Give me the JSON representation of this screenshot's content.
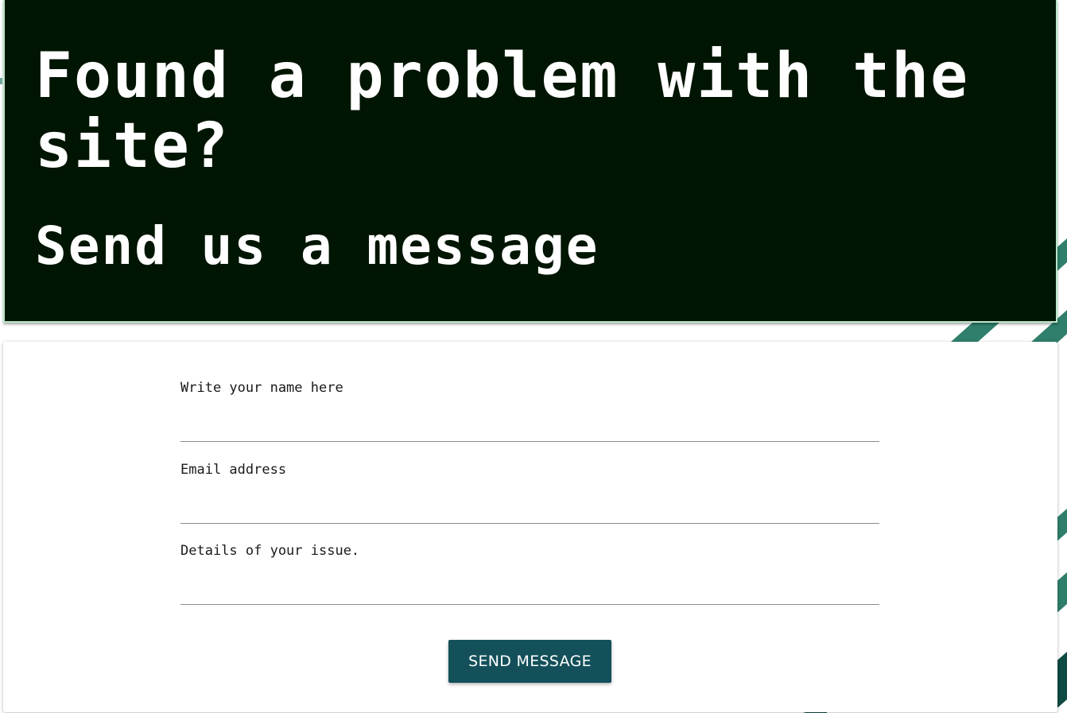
{
  "colors": {
    "hero_background": "#001502",
    "hero_border": "#b9e6c9",
    "button_background": "#13505a",
    "stripe_light": "#2f7f6c",
    "stripe_dark": "#0f4a43"
  },
  "hero": {
    "title": "Found a problem with the site?",
    "subtitle": "Send us a message"
  },
  "form": {
    "name_label": "Write your name here",
    "name_value": "",
    "email_label": "Email address",
    "email_value": "",
    "details_label": "Details of your issue.",
    "details_value": "",
    "submit_label": "SEND MESSAGE"
  }
}
